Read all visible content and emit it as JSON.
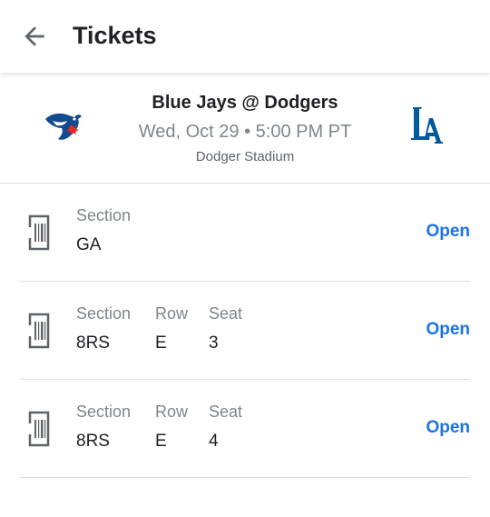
{
  "appbar": {
    "title": "Tickets"
  },
  "event": {
    "matchup": "Blue Jays @ Dodgers",
    "datetime": "Wed, Oct 29 • 5:00 PM PT",
    "venue": "Dodger Stadium",
    "away_logo": "blue-jays-logo",
    "home_logo": "dodgers-la-logo"
  },
  "colors": {
    "accent": "#1a73e8",
    "jays_blue": "#134A8E",
    "dodgers_blue": "#005A9C",
    "maple_red": "#E8291C"
  },
  "tickets": [
    {
      "section_label": "Section",
      "section": "GA",
      "action": "Open"
    },
    {
      "section_label": "Section",
      "section": "8RS",
      "row_label": "Row",
      "row": "E",
      "seat_label": "Seat",
      "seat": "3",
      "action": "Open"
    },
    {
      "section_label": "Section",
      "section": "8RS",
      "row_label": "Row",
      "row": "E",
      "seat_label": "Seat",
      "seat": "4",
      "action": "Open"
    }
  ]
}
